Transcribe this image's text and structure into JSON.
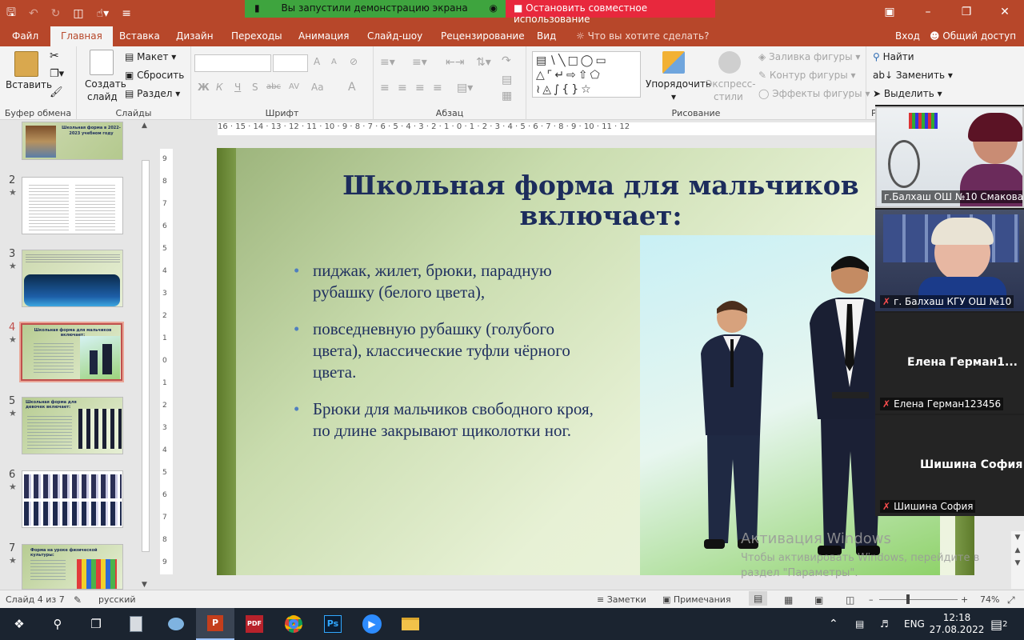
{
  "qat": {
    "save_icon": "save-icon",
    "undo_icon": "undo-icon",
    "redo_icon": "redo-icon",
    "present_icon": "present-icon",
    "touch_icon": "touch-icon",
    "more_icon": "customize-icon"
  },
  "share": {
    "green_text": "Вы запустили демонстрацию экрана",
    "red_text": "Остановить совместное использование"
  },
  "tabs": {
    "file": "Файл",
    "home": "Главная",
    "insert": "Вставка",
    "design": "Дизайн",
    "transitions": "Переходы",
    "animation": "Анимация",
    "slideshow": "Слайд-шоу",
    "review": "Рецензирование",
    "view": "Вид",
    "tellme": "Что вы хотите сделать?",
    "login": "Вход",
    "share": "Общий доступ"
  },
  "ribbon": {
    "clipboard": {
      "paste": "Вставить",
      "label": "Буфер обмена"
    },
    "slides": {
      "new_slide_1": "Создать",
      "new_slide_2": "слайд",
      "layout": "Макет",
      "reset": "Сбросить",
      "section": "Раздел",
      "label": "Слайды"
    },
    "font": {
      "bold": "Ж",
      "italic": "К",
      "underline": "Ч",
      "shadow": "S",
      "strike": "abc",
      "spacing": "AV",
      "case": "Aa",
      "color": "A",
      "grow": "A",
      "shrink": "A",
      "label": "Шрифт"
    },
    "paragraph": {
      "label": "Абзац"
    },
    "drawing": {
      "arrange_1": "Упорядочить",
      "styles_1": "Экспресс-",
      "styles_2": "стили",
      "fill": "Заливка фигуры",
      "outline": "Контур фигуры",
      "effects": "Эффекты фигуры",
      "label": "Рисование"
    },
    "editing": {
      "find": "Найти",
      "replace": "Заменить",
      "select": "Выделить",
      "label": "Р"
    }
  },
  "hruler": "16 · 15 · 14 · 13 · 12 · 11 · 10 · 9 · 8 · 7 · 6 · 5 · 4 · 3 · 2 · 1 · 0 · 1 · 2 · 3 · 4 · 5 · 6 · 7 · 8 · 9 · 10 · 11 · 12",
  "vruler": [
    "9",
    "8",
    "7",
    "6",
    "5",
    "4",
    "3",
    "2",
    "1",
    "0",
    "1",
    "2",
    "3",
    "4",
    "5",
    "6",
    "7",
    "8",
    "9"
  ],
  "thumbs": [
    {
      "num": "",
      "title": "Школьная форма в 2022-2023 учебном году"
    },
    {
      "num": "2",
      "title": ""
    },
    {
      "num": "3",
      "title": ""
    },
    {
      "num": "4",
      "title": "Школьная форма для мальчиков включает:"
    },
    {
      "num": "5",
      "title": "Школьная форма для девочек включает:"
    },
    {
      "num": "6",
      "title": ""
    },
    {
      "num": "7",
      "title": "Форма на уроке физической культуры:"
    }
  ],
  "slide": {
    "title": "Школьная форма для мальчиков включает:",
    "bullets": [
      "пиджак, жилет, брюки, парадную рубашку (белого цвета),",
      "повседневную рубашку (голубого цвета), классические туфли чёрного цвета.",
      "Брюки для мальчиков свободного кроя, по длине закрывают щиколотки ног."
    ]
  },
  "watermark": {
    "title": "Активация Windows",
    "line1": "Чтобы активировать Windows, перейдите в",
    "line2": "раздел \"Параметры\"."
  },
  "participants": [
    {
      "name": "г.Балхаш ОШ №10  Смакова ...",
      "muted": false
    },
    {
      "name": "г. Балхаш КГУ ОШ №10",
      "muted": true
    },
    {
      "big": "Елена  Герман1...",
      "name": "Елена Герман123456",
      "muted": true
    },
    {
      "big": "Шишина София",
      "name": "Шишина София",
      "muted": true
    }
  ],
  "status": {
    "slide": "Слайд 4 из 7",
    "lang": "русский",
    "notes": "Заметки",
    "comments": "Примечания",
    "zoom": "74%"
  },
  "taskbar": {
    "lang": "ENG",
    "time": "12:18",
    "date": "27.08.2022",
    "notif": "2"
  }
}
